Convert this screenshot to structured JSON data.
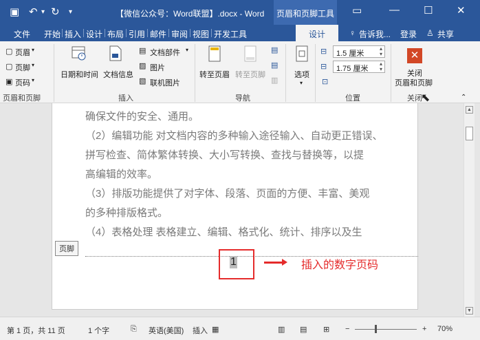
{
  "titlebar": {
    "save_icon": "save-icon",
    "undo_icon": "undo-icon",
    "redo_icon": "redo-icon",
    "customize_icon": "customize-icon",
    "title": "【微信公众号：Word联盟】.docx - Word",
    "context_tab": "页眉和页脚工具"
  },
  "tabs": {
    "file": "文件",
    "items": [
      "开始",
      "插入",
      "设计",
      "布局",
      "引用",
      "邮件",
      "审阅",
      "视图",
      "开发工具"
    ],
    "design": "设计",
    "tell_me": "告诉我...",
    "login": "登录",
    "share": "共享"
  },
  "ribbon": {
    "header": "页眉",
    "footer": "页脚",
    "page_number": "页码",
    "group_hf": "页眉和页脚",
    "date_time": "日期和时间",
    "doc_info": "文档信息",
    "doc_parts": "文档部件",
    "picture": "图片",
    "online_picture": "联机图片",
    "group_insert": "插入",
    "goto_header": "转至页眉",
    "goto_footer": "转至页脚",
    "group_nav": "导航",
    "options": "选项",
    "header_pos": "1.5 厘米",
    "footer_pos": "1.75 厘米",
    "group_pos": "位置",
    "close_line1": "关闭",
    "close_line2": "页眉和页脚",
    "group_close": "关闭"
  },
  "document": {
    "paragraphs": [
      "确保文件的安全、通用。",
      "（2）编辑功能  对文档内容的多种输入途径输入、自动更正错误、",
      "拼写检查、简体繁体转换、大小写转换、查找与替换等，以提",
      "高编辑的效率。",
      "（3）排版功能提供了对字体、段落、页面的方便、丰富、美观",
      "的多种排版格式。",
      "（4）表格处理   表格建立、编辑、格式化、统计、排序以及生"
    ],
    "footer_tag": "页脚",
    "page_number": "1",
    "annotation": "插入的数字页码"
  },
  "status": {
    "page": "第 1 页，共 11 页",
    "words": "1 个字",
    "language": "英语(美国)",
    "mode": "插入",
    "zoom": "70%"
  }
}
